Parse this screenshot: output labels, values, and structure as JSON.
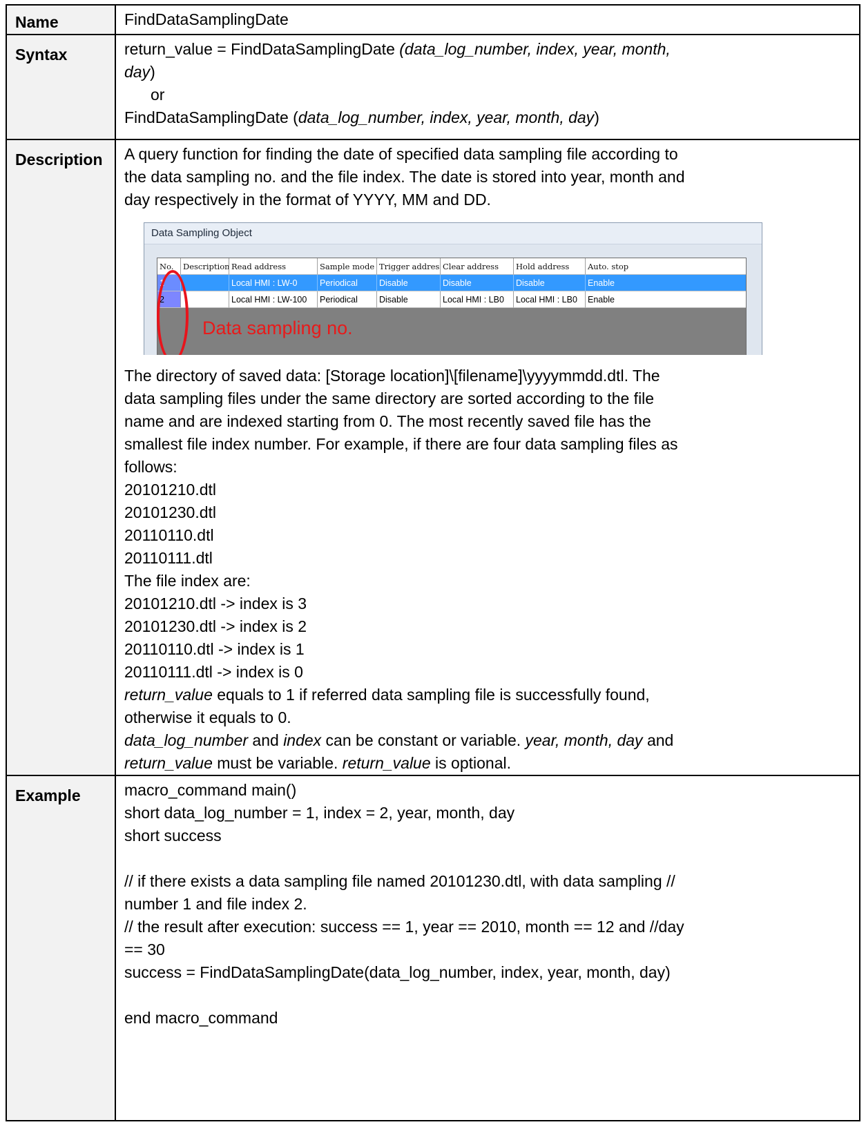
{
  "rows": {
    "name": {
      "label": "Name",
      "value": "FindDataSamplingDate"
    },
    "syntax": {
      "label": "Syntax",
      "line1_plain": "return_value = FindDataSamplingDate ",
      "line1_italic": "(data_log_number, index, year, month,",
      "line2_italic": "day",
      "line2_plain": ")",
      "line3": "or",
      "line4_plain_a": "FindDataSamplingDate (",
      "line4_italic": "data_log_number, index, year, month, day",
      "line4_plain_b": ")"
    },
    "description": {
      "label": "Description",
      "intro": [
        "A query function for finding the date of specified data sampling file according to",
        "the data sampling no. and the file index. The date is stored into year, month and",
        "day respectively in the format of YYYY, MM and DD."
      ],
      "screenshot": {
        "title": "Data Sampling Object",
        "columns": [
          "No.",
          "Description",
          "Read address",
          "Sample mode",
          "Trigger address",
          "Clear address",
          "Hold address",
          "Auto. stop"
        ],
        "rows": [
          [
            "1",
            "",
            "Local HMI : LW-0",
            "Periodical",
            "Disable",
            "Disable",
            "Disable",
            "Enable"
          ],
          [
            "2",
            "",
            "Local HMI : LW-100",
            "Periodical",
            "Disable",
            "Local HMI : LB0",
            "Local HMI : LB0",
            "Enable"
          ]
        ],
        "annotation": "Data sampling no.",
        "annotation_color": "#e81a1a",
        "selected_row_color": "#3399ff"
      },
      "body": [
        "The directory of saved data: [Storage location]\\[filename]\\yyyymmdd.dtl. The",
        "data sampling files under the same directory are sorted according to the file",
        "name and are indexed starting from 0. The most recently saved file has the",
        "smallest file index number. For example, if there are four data sampling files as",
        "follows:",
        "20101210.dtl",
        "20101230.dtl",
        "20110110.dtl",
        "20110111.dtl",
        "The file index are:",
        "20101210.dtl -> index is 3",
        "20101230.dtl -> index is 2",
        "20110110.dtl -> index is 1",
        "20110111.dtl -> index is 0"
      ],
      "rv_italic": "return_value",
      "rv_rest": " equals to 1 if referred data sampling file is successfully found,",
      "rv_line2": "otherwise it equals to 0.",
      "n1_italic": "data_log_number",
      "n1_mid": " and ",
      "n1_italic2": "index",
      "n1_mid2": " can be constant or variable. ",
      "n1_italic3": "year, month, day",
      "n1_end": " and",
      "n2_italic": "return_value",
      "n2_mid": " must be variable. ",
      "n2_italic2": "return_value",
      "n2_end": " is optional."
    },
    "example": {
      "label": "Example",
      "lines": [
        "macro_command main()",
        "short data_log_number = 1, index = 2, year, month, day",
        "short success",
        "",
        "// if there exists a data sampling file named 20101230.dtl, with data sampling //",
        "number 1 and file index 2.",
        "// the result after execution: success == 1, year == 2010, month == 12 and //day",
        "== 30",
        "success = FindDataSamplingDate(data_log_number, index, year, month, day)",
        "",
        "end macro_command"
      ]
    }
  }
}
